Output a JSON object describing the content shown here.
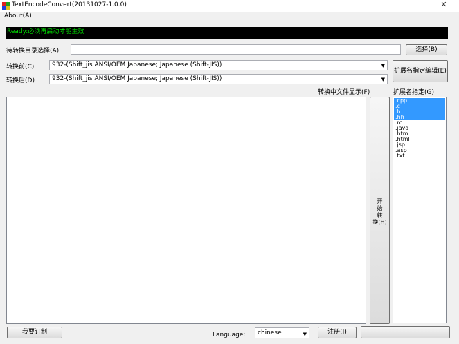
{
  "window": {
    "title": "TextEncodeConvert(20131027-1.0.0)"
  },
  "menu": {
    "about": "About(A)"
  },
  "status": {
    "message": "Ready:必须再启动才能生效"
  },
  "form": {
    "dir_label": "待转换目录选择(A)",
    "dir_value": "",
    "select_button": "选择(B)",
    "before_label": "转换前(C)",
    "before_value": "932-(Shift_jis ANSI/OEM Japanese; Japanese (Shift-JIS))",
    "after_label": "转换后(D)",
    "after_value": "932-(Shift_jis ANSI/OEM Japanese; Japanese (Shift-JIS))",
    "ext_edit_button": "扩展名指定编辑(E)"
  },
  "file_display": {
    "label": "转换中文件显示(F)"
  },
  "extensions": {
    "label": "扩展名指定(G)",
    "items": [
      {
        "name": ".cpp",
        "selected": true
      },
      {
        "name": ".c",
        "selected": true
      },
      {
        "name": ".h",
        "selected": true
      },
      {
        "name": ".hh",
        "selected": true
      },
      {
        "name": ".rc",
        "selected": false
      },
      {
        "name": ".java",
        "selected": false
      },
      {
        "name": ".htm",
        "selected": false
      },
      {
        "name": ".html",
        "selected": false
      },
      {
        "name": ".jsp",
        "selected": false
      },
      {
        "name": ".asp",
        "selected": false
      },
      {
        "name": ".txt",
        "selected": false
      }
    ]
  },
  "start_button": {
    "chars": [
      "开",
      "始",
      "转",
      "换(H)"
    ]
  },
  "bottom": {
    "order_button": "我要订制",
    "language_label": "Language:",
    "language_value": "chinese",
    "register_button": "注册(I)"
  },
  "colors": {
    "status_bg": "#000000",
    "status_text": "#00e000",
    "selection": "#3399ff"
  }
}
